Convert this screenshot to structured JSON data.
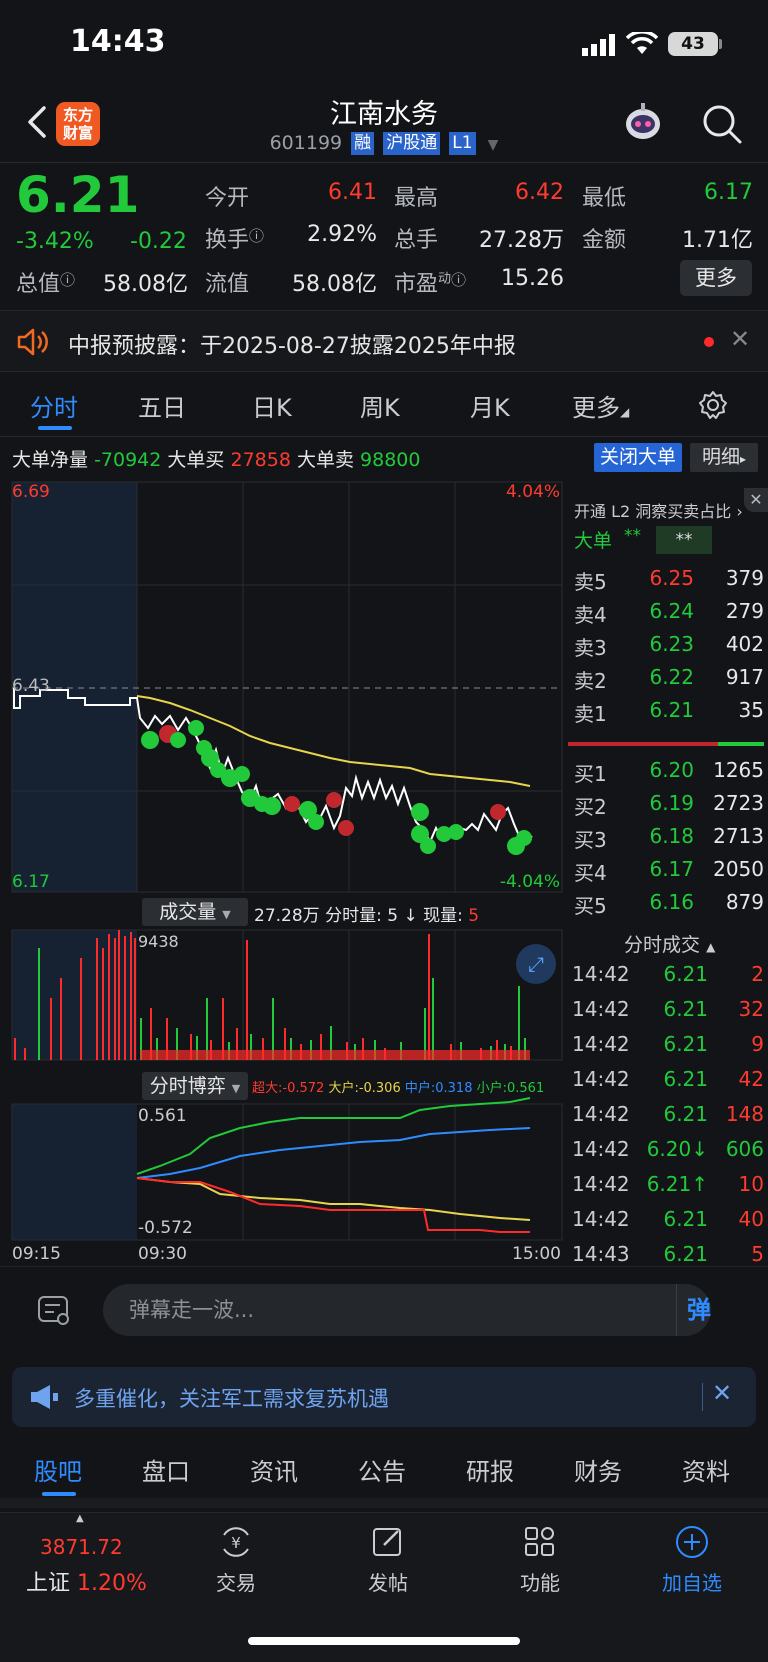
{
  "status": {
    "time": "14:43",
    "battery": "43"
  },
  "header": {
    "logo_text": "东方财富",
    "stock_name": "江南水务",
    "code": "601199",
    "tags": [
      "融",
      "沪股通",
      "L1"
    ]
  },
  "quote": {
    "price": "6.21",
    "change_pct": "-3.42%",
    "change": "-0.22",
    "open_label": "今开",
    "open": "6.41",
    "high_label": "最高",
    "high": "6.42",
    "low_label": "最低",
    "low": "6.17",
    "turnover_label": "换手",
    "turnover": "2.92%",
    "volume_label": "总手",
    "volume": "27.28万",
    "amount_label": "金额",
    "amount": "1.71亿",
    "mktcap_label": "总值",
    "mktcap": "58.08亿",
    "float_label": "流值",
    "float_cap": "58.08亿",
    "pe_label": "市盈",
    "pe_sup": "动",
    "pe": "15.26",
    "more_label": "更多"
  },
  "notice": {
    "text": "中报预披露：于2025-08-27披露2025年中报"
  },
  "chart_tabs": [
    "分时",
    "五日",
    "日K",
    "周K",
    "月K",
    "更多"
  ],
  "big_order": {
    "net_label": "大单净量",
    "net": "-70942",
    "buy_label": "大单买",
    "buy": "27858",
    "sell_label": "大单卖",
    "sell": "98800",
    "close_btn": "关闭大单",
    "detail_btn": "明细"
  },
  "price_chart": {
    "high_label": "6.69",
    "high_pct": "4.04%",
    "low_label": "6.17",
    "low_pct": "-4.04%",
    "prev_close_label": "6.43"
  },
  "volume_panel": {
    "selector": "成交量",
    "info_total": "27.28万",
    "info_minute": "分时量: 5",
    "info_now_label": "↓ 现量:",
    "info_now": "5",
    "max_label": "9438"
  },
  "game_panel": {
    "selector": "分时博弈",
    "super": "超大:-0.572",
    "large": "大户:-0.306",
    "mid": "中户:0.318",
    "small": "小户:0.561",
    "max_label": "0.561",
    "min_label": "-0.572"
  },
  "time_axis": [
    "09:15",
    "09:30",
    "15:00"
  ],
  "order_book": {
    "l2_title": "开通 L2 洞察买卖占比",
    "big_label": "大单",
    "big_val1": "**",
    "big_val2": "**",
    "asks": [
      {
        "label": "卖5",
        "price": "6.25",
        "vol": "379"
      },
      {
        "label": "卖4",
        "price": "6.24",
        "vol": "279"
      },
      {
        "label": "卖3",
        "price": "6.23",
        "vol": "402"
      },
      {
        "label": "卖2",
        "price": "6.22",
        "vol": "917"
      },
      {
        "label": "卖1",
        "price": "6.21",
        "vol": "35"
      }
    ],
    "bids": [
      {
        "label": "买1",
        "price": "6.20",
        "vol": "1265"
      },
      {
        "label": "买2",
        "price": "6.19",
        "vol": "2723"
      },
      {
        "label": "买3",
        "price": "6.18",
        "vol": "2713"
      },
      {
        "label": "买4",
        "price": "6.17",
        "vol": "2050"
      },
      {
        "label": "买5",
        "price": "6.16",
        "vol": "879"
      }
    ]
  },
  "trades": {
    "title": "分时成交",
    "rows": [
      {
        "time": "14:42",
        "price": "6.21",
        "vol": "2",
        "dir": "up"
      },
      {
        "time": "14:42",
        "price": "6.21",
        "vol": "32",
        "dir": "up"
      },
      {
        "time": "14:42",
        "price": "6.21",
        "vol": "9",
        "dir": "up"
      },
      {
        "time": "14:42",
        "price": "6.21",
        "vol": "42",
        "dir": "up"
      },
      {
        "time": "14:42",
        "price": "6.21",
        "vol": "148",
        "dir": "up"
      },
      {
        "time": "14:42",
        "price": "6.20↓",
        "vol": "606",
        "dir": "down"
      },
      {
        "time": "14:42",
        "price": "6.21↑",
        "vol": "10",
        "dir": "up"
      },
      {
        "time": "14:42",
        "price": "6.21",
        "vol": "40",
        "dir": "up"
      },
      {
        "time": "14:43",
        "price": "6.21",
        "vol": "5",
        "dir": "up"
      }
    ]
  },
  "danmu": {
    "placeholder": "弹幕走一波...",
    "send": "弹"
  },
  "promo": {
    "text": "多重催化，关注军工需求复苏机遇"
  },
  "bottom_tabs": [
    "股吧",
    "盘口",
    "资讯",
    "公告",
    "研报",
    "财务",
    "资料"
  ],
  "footer": {
    "index_value": "3871.72",
    "index_name": "上证",
    "index_pct": "1.20%",
    "trade": "交易",
    "post": "发帖",
    "func": "功能",
    "add": "加自选"
  }
}
